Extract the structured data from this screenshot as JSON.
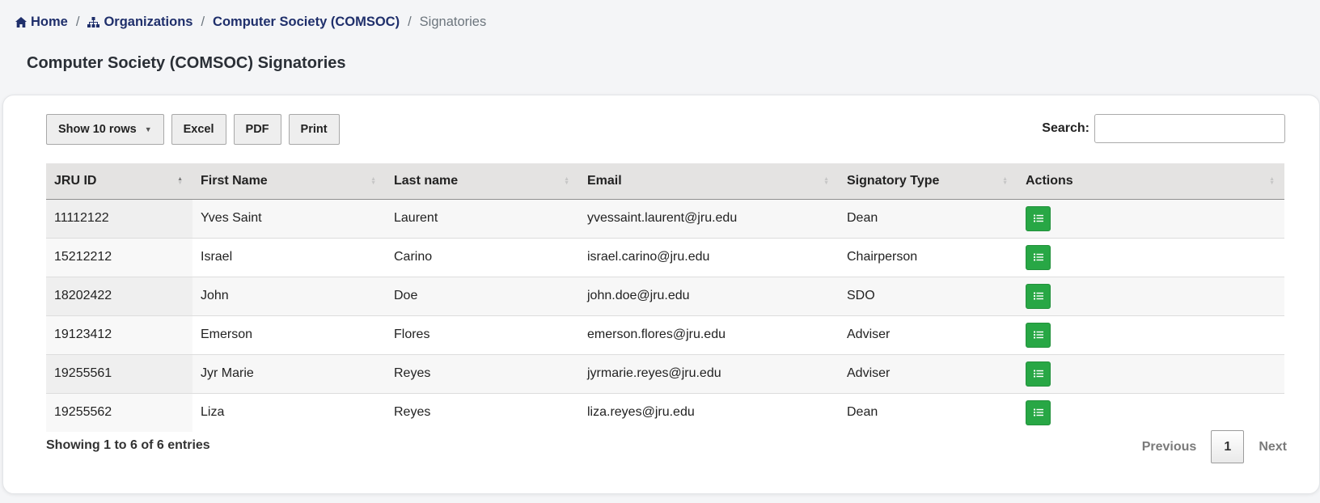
{
  "breadcrumb": {
    "home": "Home",
    "organizations": "Organizations",
    "organization": "Computer Society (COMSOC)",
    "current": "Signatories",
    "separator": "/"
  },
  "page": {
    "title": "Computer Society (COMSOC) Signatories"
  },
  "toolbar": {
    "show_rows": "Show 10 rows",
    "excel": "Excel",
    "pdf": "PDF",
    "print": "Print"
  },
  "search": {
    "label": "Search:",
    "value": ""
  },
  "table": {
    "columns": [
      "JRU ID",
      "First Name",
      "Last name",
      "Email",
      "Signatory Type",
      "Actions"
    ],
    "sorted_column": "JRU ID",
    "sort_direction": "ascending",
    "rows": [
      {
        "jru_id": "11112122",
        "first_name": "Yves Saint",
        "last_name": "Laurent",
        "email": "yvessaint.laurent@jru.edu",
        "signatory_type": "Dean"
      },
      {
        "jru_id": "15212212",
        "first_name": "Israel",
        "last_name": "Carino",
        "email": "israel.carino@jru.edu",
        "signatory_type": "Chairperson"
      },
      {
        "jru_id": "18202422",
        "first_name": "John",
        "last_name": "Doe",
        "email": "john.doe@jru.edu",
        "signatory_type": "SDO"
      },
      {
        "jru_id": "19123412",
        "first_name": "Emerson",
        "last_name": "Flores",
        "email": "emerson.flores@jru.edu",
        "signatory_type": "Adviser"
      },
      {
        "jru_id": "19255561",
        "first_name": "Jyr Marie",
        "last_name": "Reyes",
        "email": "jyrmarie.reyes@jru.edu",
        "signatory_type": "Adviser"
      },
      {
        "jru_id": "19255562",
        "first_name": "Liza",
        "last_name": "Reyes",
        "email": "liza.reyes@jru.edu",
        "signatory_type": "Dean"
      }
    ],
    "action_icon": "list-icon"
  },
  "footer": {
    "info": "Showing 1 to 6 of 6 entries",
    "previous": "Previous",
    "current_page": "1",
    "next": "Next"
  },
  "icons": {
    "home": "home-icon",
    "organizations": "sitemap-icon",
    "action": "list-icon",
    "dropdown": "caret-down-icon"
  },
  "colors": {
    "breadcrumb_link": "#1f2f6b",
    "action_button": "#28a745",
    "header_row": "#e4e3e2"
  }
}
